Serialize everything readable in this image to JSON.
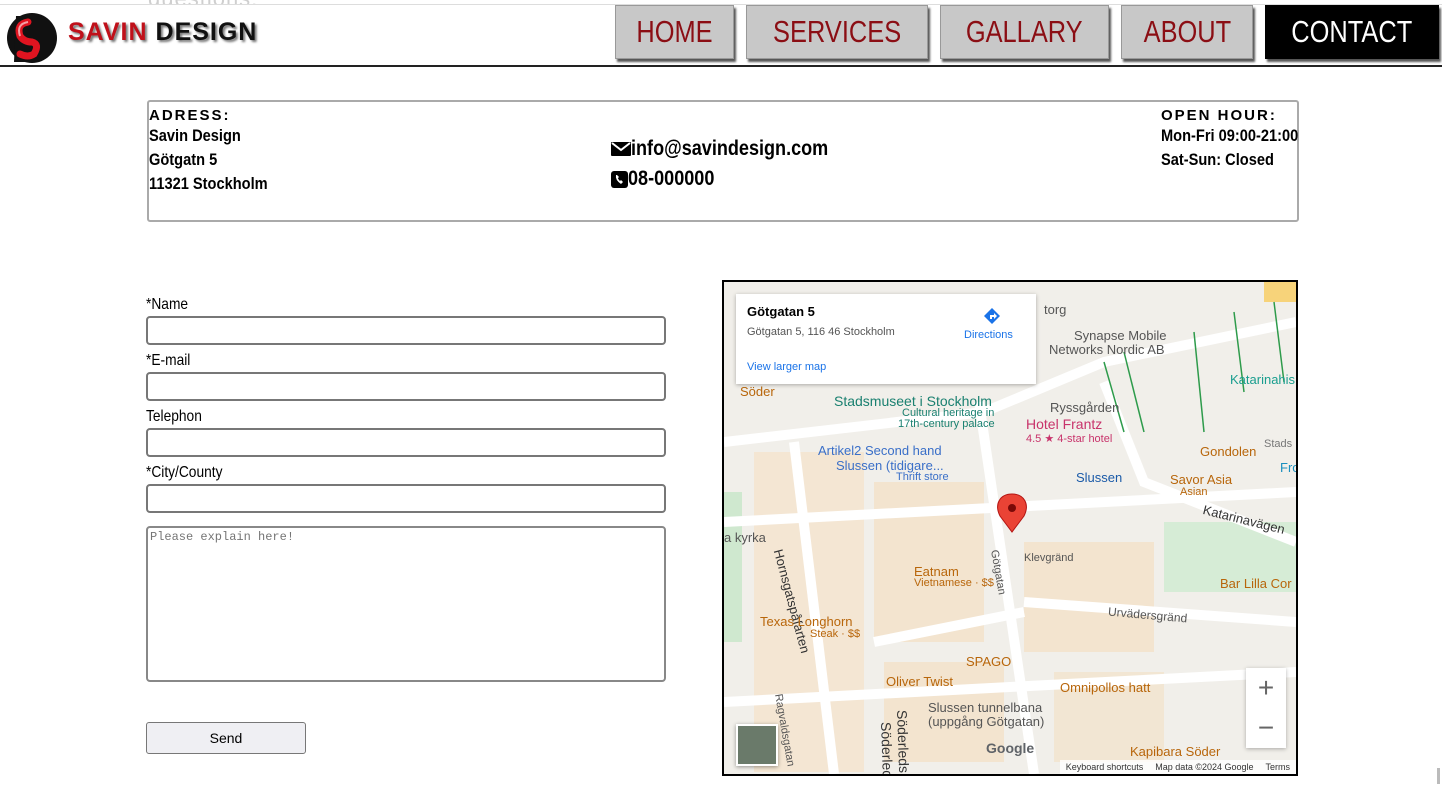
{
  "behind_text": "questions.",
  "brand": {
    "part1": "SAVIN",
    "part2": "DESIGN"
  },
  "nav": [
    {
      "label": "HOME",
      "active": false
    },
    {
      "label": "SERVICES",
      "active": false
    },
    {
      "label": "GALLARY",
      "active": false
    },
    {
      "label": "ABOUT",
      "active": false
    },
    {
      "label": "CONTACT",
      "active": true
    }
  ],
  "info": {
    "address_label": "ADRESS:",
    "address_lines": [
      "Savin Design",
      "Götgatn 5",
      "11321 Stockholm"
    ],
    "email": "info@savindesign.com",
    "phone": "08-000000",
    "hours_label": "OPEN HOUR:",
    "hours_lines": [
      "Mon-Fri 09:00-21:00",
      "Sat-Sun: Closed"
    ]
  },
  "form": {
    "name_label": "*Name",
    "email_label": "*E-mail",
    "phone_label": "Telephon",
    "city_label": "*City/County",
    "message_placeholder": "Please explain here!",
    "send_label": "Send"
  },
  "map": {
    "place_title": "Götgatan 5",
    "place_address": "Götgatan 5, 116 46 Stockholm",
    "directions": "Directions",
    "view_larger": "View larger map",
    "zoom_in": "+",
    "zoom_out": "−",
    "labels": {
      "torg": "torg",
      "synapse1": "Synapse Mobile",
      "synapse2": "Networks Nordic AB",
      "katarinahis": "Katarinahis",
      "soder": "Söder",
      "stadsmuseet": "Stadsmuseet i Stockholm",
      "cultural1": "Cultural heritage in",
      "cultural2": "17th-century palace",
      "ryssgarden": "Ryssgården",
      "hotel": "Hotel Frantz",
      "hotel_rating": "4.5 ★ 4-star hotel",
      "stads": "Stads",
      "artikel1": "Artikel2 Second hand",
      "artikel2": "Slussen (tidigare...",
      "thrift": "Thrift store",
      "slussen": "Slussen",
      "gondolen": "Gondolen",
      "fro": "Fro",
      "savor": "Savor Asia",
      "asian": "Asian",
      "katarinavagen": "Katarinavägen",
      "hornsgats": "Hornsgatspåfarten",
      "akyrka": "a kyrka",
      "klevgrand": "Klevgränd",
      "gotgatan": "Götgatan",
      "barlilla": "Bar Lilla Cor",
      "eatnam": "Eatnam",
      "vietnamese": "Vietnamese · $$",
      "urvaders": "Urvädersgränd",
      "texas": "Texas Longhorn",
      "steak": "Steak · $$",
      "spago": "SPAGO",
      "oliver": "Oliver Twist",
      "omnipollos": "Omnipollos hatt",
      "slussen_t1": "Slussen tunnelbana",
      "slussen_t2": "(uppgång Götgatan)",
      "ragvalds": "Ragvaldsgatan",
      "soderleds": "Söderleds",
      "soderleo": "Söderleo",
      "kapibara": "Kapibara Söder",
      "google": "Google"
    },
    "attribution": [
      "Keyboard shortcuts",
      "Map data ©2024 Google",
      "Terms"
    ]
  }
}
